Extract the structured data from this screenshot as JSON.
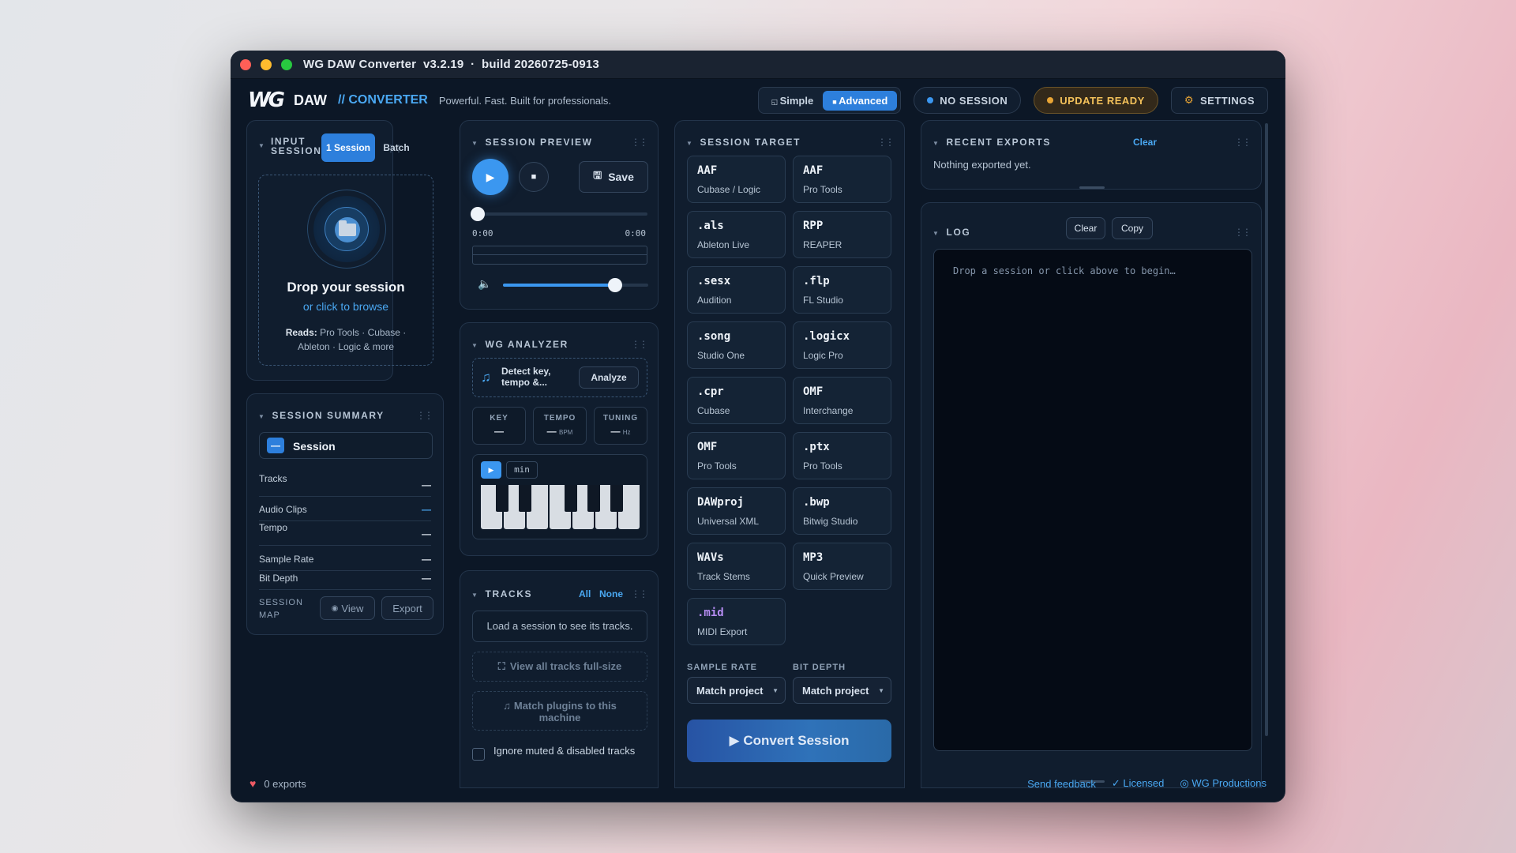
{
  "window": {
    "title": "WG DAW Converter  v3.2.19  ·  build 20260725-0913"
  },
  "header": {
    "logo": "WG",
    "brand": "DAW",
    "product": "// CONVERTER",
    "tagline": "Powerful. Fast. Built for professionals.",
    "modes": [
      "Simple",
      "Advanced"
    ],
    "active_mode": "Advanced",
    "session_status": "NO SESSION",
    "update_status": "UPDATE READY",
    "settings": "SETTINGS"
  },
  "input_session": {
    "title": "INPUT SESSION",
    "tabs": [
      "1 Session",
      "Batch"
    ],
    "drop_title": "Drop your session",
    "drop_link": "or click to browse",
    "reads_label": "Reads:",
    "reads_text": "Pro Tools · Cubase · Ableton · Logic & more"
  },
  "session_summary": {
    "title": "SESSION SUMMARY",
    "name": "Session",
    "badge": "—",
    "rows": [
      {
        "label": "Tracks",
        "value": "—"
      },
      {
        "label": "Audio Clips",
        "value": "—"
      },
      {
        "label": "Tempo",
        "value": "—"
      },
      {
        "label": "Sample Rate",
        "value": "—"
      },
      {
        "label": "Bit Depth",
        "value": "—"
      }
    ],
    "map_label": "SESSION MAP",
    "view": "View",
    "export": "Export"
  },
  "session_preview": {
    "title": "SESSION PREVIEW",
    "save": "Save",
    "time_start": "0:00",
    "time_end": "0:00",
    "position": 0,
    "volume": 0.8
  },
  "analyzer": {
    "title": "WG ANALYZER",
    "detect": "Detect key, tempo &...",
    "analyze": "Analyze",
    "stats": [
      {
        "label": "KEY",
        "value": "—",
        "unit": ""
      },
      {
        "label": "TEMPO",
        "value": "—",
        "unit": "BPM"
      },
      {
        "label": "TUNING",
        "value": "—",
        "unit": "Hz"
      }
    ],
    "piano_mode": "min"
  },
  "tracks": {
    "title": "TRACKS",
    "all": "All",
    "none": "None",
    "empty": "Load a session to see its tracks.",
    "view_full": "View all tracks full-size",
    "match_plugins": "Match plugins to this machine",
    "ignore_muted": "Ignore muted & disabled tracks"
  },
  "session_target": {
    "title": "SESSION TARGET",
    "formats": [
      {
        "ext": "AAF",
        "app": "Cubase / Logic"
      },
      {
        "ext": "AAF",
        "app": "Pro Tools"
      },
      {
        "ext": ".als",
        "app": "Ableton Live"
      },
      {
        "ext": "RPP",
        "app": "REAPER"
      },
      {
        "ext": ".sesx",
        "app": "Audition"
      },
      {
        "ext": ".flp",
        "app": "FL Studio"
      },
      {
        "ext": ".song",
        "app": "Studio One"
      },
      {
        "ext": ".logicx",
        "app": "Logic Pro"
      },
      {
        "ext": ".cpr",
        "app": "Cubase"
      },
      {
        "ext": "OMF",
        "app": "Interchange"
      },
      {
        "ext": "OMF",
        "app": "Pro Tools"
      },
      {
        "ext": ".ptx",
        "app": "Pro Tools"
      },
      {
        "ext": "DAWproj",
        "app": "Universal XML"
      },
      {
        "ext": ".bwp",
        "app": "Bitwig Studio"
      },
      {
        "ext": "WAVs",
        "app": "Track Stems"
      },
      {
        "ext": "MP3",
        "app": "Quick Preview"
      },
      {
        "ext": ".mid",
        "app": "MIDI Export"
      }
    ],
    "sample_rate_label": "SAMPLE RATE",
    "bit_depth_label": "BIT DEPTH",
    "sample_rate_value": "Match project",
    "bit_depth_value": "Match project",
    "convert": "▶ Convert Session"
  },
  "recent_exports": {
    "title": "RECENT EXPORTS",
    "clear": "Clear",
    "empty": "Nothing exported yet."
  },
  "log": {
    "title": "LOG",
    "clear": "Clear",
    "copy": "Copy",
    "placeholder": "Drop a session or click above to begin…"
  },
  "footer": {
    "exports": "0 exports",
    "feedback": "Send feedback",
    "licensed": "✓ Licensed",
    "company": "◎ WG Productions"
  },
  "colors": {
    "accent": "#3b97f0",
    "update": "#f3c15a",
    "midi": "#b58cf2"
  }
}
